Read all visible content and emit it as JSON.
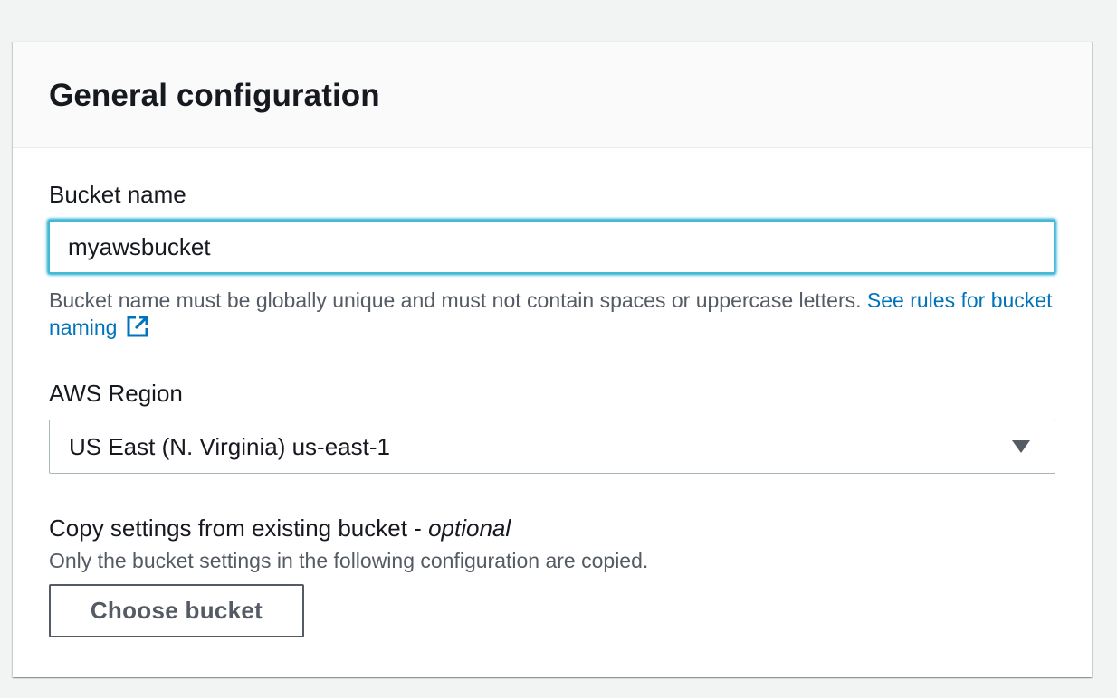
{
  "panel": {
    "title": "General configuration"
  },
  "bucket_name": {
    "label": "Bucket name",
    "value": "myawsbucket",
    "hint_text": "Bucket name must be globally unique and must not contain spaces or uppercase letters. ",
    "hint_link": "See rules for bucket naming",
    "link_icon": "external-link-icon"
  },
  "region": {
    "label": "AWS Region",
    "selected": "US East (N. Virginia) us-east-1",
    "dropdown_icon": "caret-down-icon"
  },
  "copy_settings": {
    "label": "Copy settings from existing bucket - ",
    "label_optional": "optional",
    "hint": "Only the bucket settings in the following configuration are copied.",
    "button_label": "Choose bucket"
  },
  "colors": {
    "link": "#0073bb",
    "focus_border": "#44b9d6",
    "text": "#16191f",
    "secondary_text": "#545b64"
  }
}
